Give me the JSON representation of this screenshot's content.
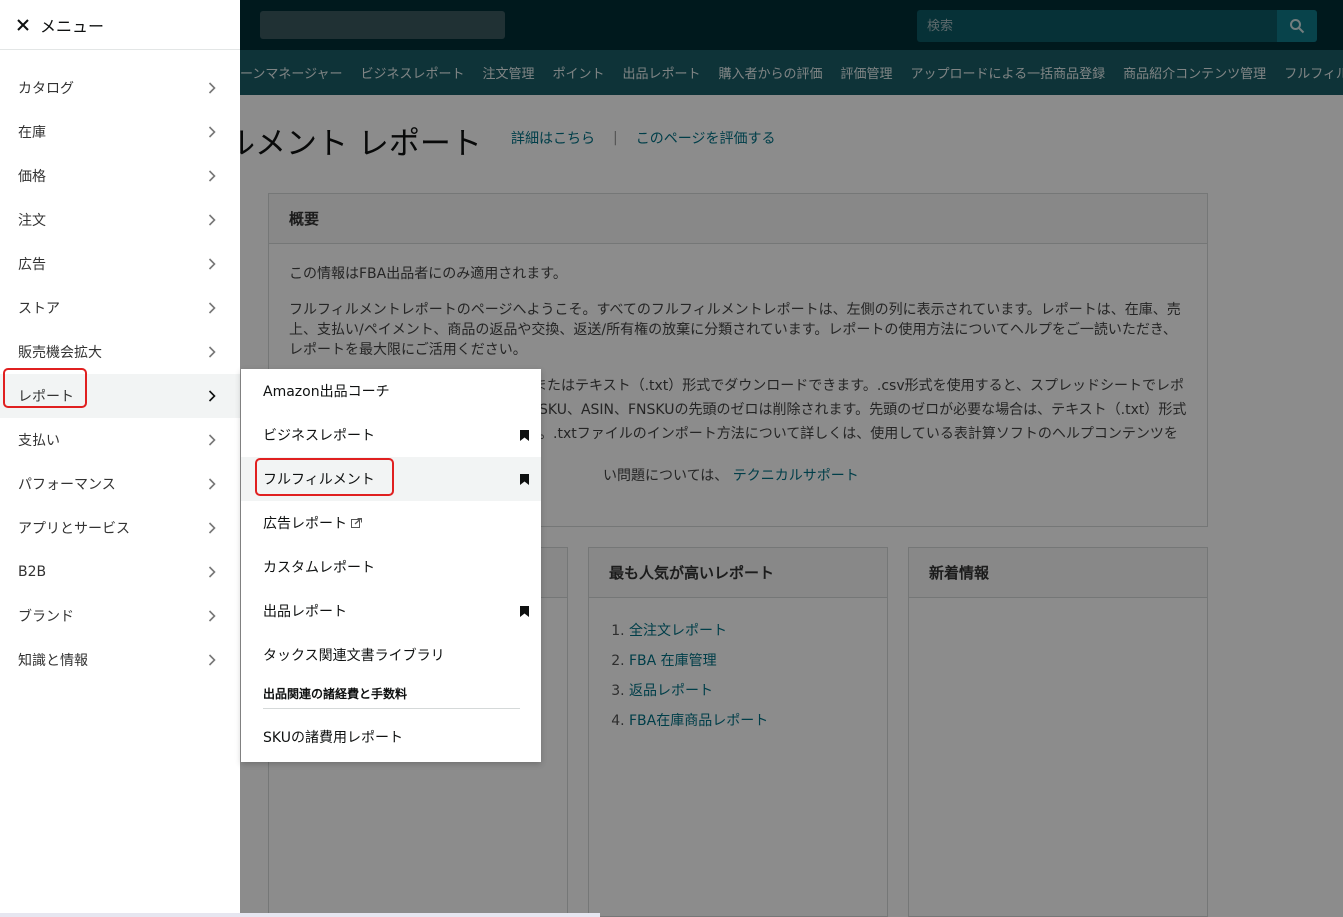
{
  "top": {
    "search_placeholder": "検索"
  },
  "navbar": {
    "items": [
      "ーンマネージャー",
      "ビジネスレポート",
      "注文管理",
      "ポイント",
      "出品レポート",
      "購入者からの評価",
      "評価管理",
      "アップロードによる一括商品登録",
      "商品紹介コンテンツ管理",
      "フルフィル"
    ]
  },
  "page": {
    "title": "ルメント レポート",
    "link_details": "詳細はこちら",
    "link_separator": "|",
    "link_rate": "このページを評価する"
  },
  "overview": {
    "heading": "概要",
    "p1": "この情報はFBA出品者にのみ適用されます。",
    "p2": "フルフィルメントレポートのページへようこそ。すべてのフルフィルメントレポートは、左側の列に表示されています。レポートは、在庫、売上、支払い/ペイメント、商品の返品や交換、返送/所有権の放棄に分類されています。レポートの使用方法についてヘルプをご一読いただき、レポートを最大限にご活用ください。",
    "p3": "またはテキスト（.txt）形式でダウンロードできます。.csv形式を使用すると、スプレッドシートでレポ",
    "p3b": "SKU、ASIN、FNSKUの先頭のゼロは削除されます。先頭のゼロが必要な場合は、テキスト（.txt）形式",
    "p3c": "。.txtファイルのインポート方法について詳しくは、使用している表計算ソフトのヘルプコンテンツを",
    "p4": "い問題については、",
    "p4_link": "テクニカルサポート"
  },
  "popular": {
    "heading": "最も人気が高いレポート",
    "items": [
      "全注文レポート",
      "FBA 在庫管理",
      "返品レポート",
      "FBA在庫商品レポート"
    ]
  },
  "news": {
    "heading": "新着情報"
  },
  "menu": {
    "title": "メニュー",
    "items": [
      "カタログ",
      "在庫",
      "価格",
      "注文",
      "広告",
      "ストア",
      "販売機会拡大",
      "レポート",
      "支払い",
      "パフォーマンス",
      "アプリとサービス",
      "B2B",
      "ブランド",
      "知識と情報"
    ]
  },
  "submenu": {
    "items": [
      "Amazon出品コーチ",
      "ビジネスレポート",
      "フルフィルメント",
      "広告レポート",
      "カスタムレポート",
      "出品レポート",
      "タックス関連文書ライブラリ"
    ],
    "section_heading": "出品関連の諸経費と手数料",
    "section_item": "SKUの諸費用レポート"
  },
  "colors": {
    "highlight": "#e02020",
    "header": "#002f36",
    "link": "#007185"
  }
}
